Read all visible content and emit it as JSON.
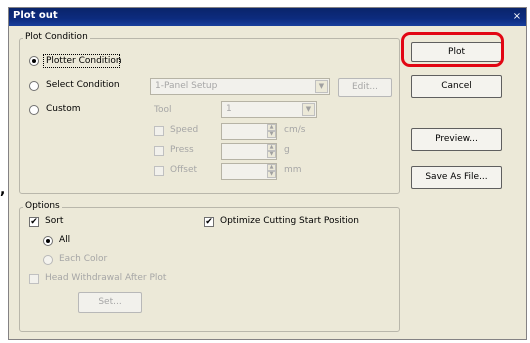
{
  "window": {
    "title": "Plot out",
    "close_glyph": "×"
  },
  "plot_condition": {
    "group_label": "Plot Condition",
    "plotter_condition_label": "Plotter Condition",
    "select_condition_label": "Select Condition",
    "custom_label": "Custom",
    "selected_option": "Plotter Condition",
    "setup_combo_value": "1-Panel Setup",
    "edit_button_label": "Edit...",
    "tool_label": "Tool",
    "tool_combo_value": "1",
    "speed_label": "Speed",
    "speed_unit": "cm/s",
    "press_label": "Press",
    "press_unit": "g",
    "offset_label": "Offset",
    "offset_unit": "mm"
  },
  "options": {
    "group_label": "Options",
    "sort_label": "Sort",
    "sort_checked": true,
    "all_label": "All",
    "each_color_label": "Each Color",
    "optimize_label": "Optimize Cutting Start Position",
    "optimize_checked": true,
    "head_withdrawal_label": "Head Withdrawal After Plot",
    "head_withdrawal_checked": false,
    "set_button_label": "Set..."
  },
  "buttons": {
    "plot": "Plot",
    "cancel": "Cancel",
    "preview": "Preview...",
    "save_as_file": "Save As File..."
  },
  "annotation": {
    "highlight_color": "#e20613",
    "stray_mark": ","
  },
  "icons": {
    "check": "✔",
    "combo_arrow": "▼",
    "spin_up": "▲",
    "spin_down": "▼"
  }
}
